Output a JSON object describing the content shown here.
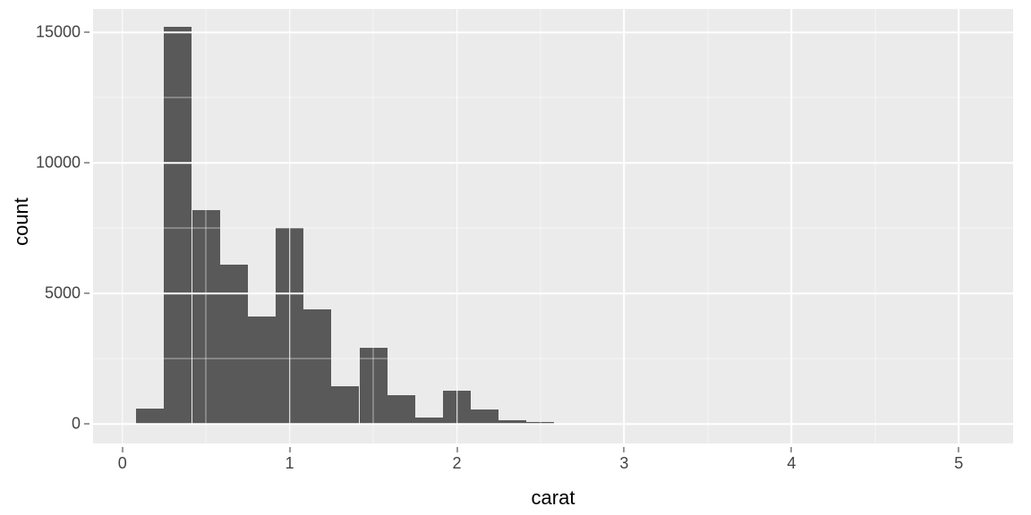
{
  "chart_data": {
    "type": "bar",
    "xlabel": "carat",
    "ylabel": "count",
    "xlim": [
      -0.175,
      5.325
    ],
    "ylim": [
      -750,
      15900
    ],
    "x_ticks": [
      0,
      1,
      2,
      3,
      4,
      5
    ],
    "y_ticks": [
      0,
      5000,
      10000,
      15000
    ],
    "y_tick_labels": [
      "0",
      "5000",
      "10000",
      "15000"
    ],
    "bin_width": 0.166,
    "bin_centers": [
      0.167,
      0.333,
      0.5,
      0.667,
      0.833,
      1.0,
      1.167,
      1.333,
      1.5,
      1.667,
      1.833,
      2.0,
      2.167,
      2.333,
      2.5
    ],
    "values": [
      600,
      15200,
      8200,
      6100,
      4100,
      7500,
      4400,
      1450,
      2900,
      1100,
      260,
      1280,
      550,
      150,
      70
    ],
    "bar_fill": "#595959",
    "panel_bg": "#ebebeb",
    "grid_color": "#ffffff"
  }
}
